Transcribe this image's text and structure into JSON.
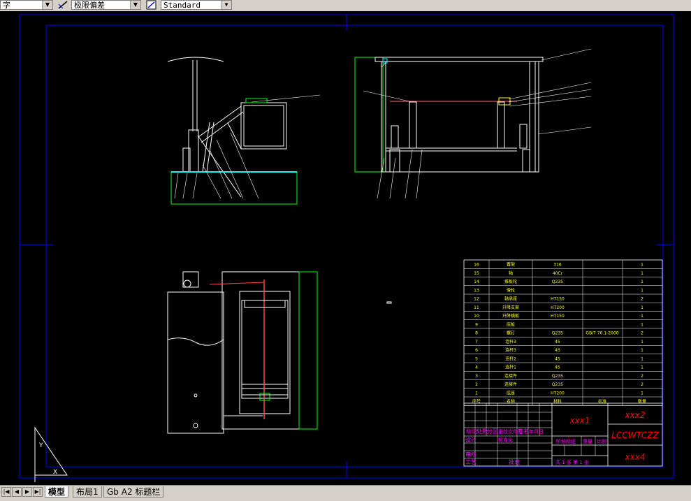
{
  "toolbar": {
    "text_style_value": "字",
    "dim_style_value": "极限偏差",
    "table_style_value": "Standard"
  },
  "tabs": {
    "model": "模型",
    "layout1": "布局1",
    "layout2": "Gb A2 标题栏"
  },
  "title_block": {
    "field1": "xxx1",
    "field2": "xxx2",
    "drawing_no": "LCCWTCZZ",
    "field4": "xxx4",
    "row_labels": [
      "标记",
      "处数",
      "分区",
      "更改文件号",
      "签名",
      "年月日"
    ],
    "labels_left": [
      "设计",
      "标准化",
      "审核",
      "工艺",
      "批准"
    ],
    "mid_labels": [
      "阶段标记",
      "重量",
      "比例"
    ],
    "sheet_label": "共 1 张 第 1 张"
  },
  "bom": {
    "rows": [
      {
        "no": "16",
        "name": "置架",
        "code": "316",
        "qty": "1"
      },
      {
        "no": "15",
        "name": "轴",
        "code": "40Cr",
        "qty": "1"
      },
      {
        "no": "14",
        "name": "推板轮",
        "code": "Q235",
        "qty": "1"
      },
      {
        "no": "13",
        "name": "滑轮",
        "code": "",
        "qty": "1"
      },
      {
        "no": "12",
        "name": "轴承座",
        "code": "HT150",
        "qty": "2"
      },
      {
        "no": "11",
        "name": "升降支架",
        "code": "HT200",
        "qty": "1"
      },
      {
        "no": "10",
        "name": "升降横板",
        "code": "HT150",
        "qty": "1"
      },
      {
        "no": "9",
        "name": "底板",
        "code": "",
        "qty": "1"
      },
      {
        "no": "8",
        "name": "螺钉",
        "code": "Q235",
        "std": "GB/T 70.1-2000",
        "qty": "2"
      },
      {
        "no": "7",
        "name": "连杆3",
        "code": "45",
        "qty": "1"
      },
      {
        "no": "6",
        "name": "连杆3",
        "code": "45",
        "qty": "1"
      },
      {
        "no": "5",
        "name": "连杆2",
        "code": "45",
        "qty": "1"
      },
      {
        "no": "4",
        "name": "连杆1",
        "code": "45",
        "qty": "1"
      },
      {
        "no": "3",
        "name": "连接件",
        "code": "Q235",
        "qty": "2"
      },
      {
        "no": "2",
        "name": "连接件",
        "code": "Q235",
        "qty": "2"
      },
      {
        "no": "1",
        "name": "底座",
        "code": "HT200",
        "qty": "1"
      }
    ],
    "header": {
      "no": "序号",
      "name": "名称",
      "code": "材料",
      "std": "标准",
      "qty": "数量"
    }
  },
  "colors": {
    "frame": "#0000ff",
    "part": "#ffffff",
    "bom_text": "#ffff00",
    "magenta": "#ff00ff",
    "red": "#ff0000",
    "green": "#00ff00",
    "cyan": "#00ffff"
  }
}
